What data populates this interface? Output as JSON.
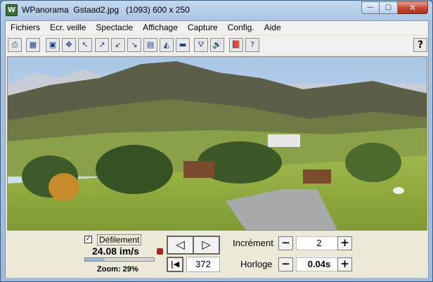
{
  "window": {
    "title": "WPanorama  Gstaad2.jpg   (1093) 600 x 250",
    "app_icon_glyph": "W",
    "minimize_glyph": "—",
    "maximize_glyph": "▢",
    "close_glyph": "✕"
  },
  "menu": {
    "items": [
      "Fichiers",
      "Ecr. veille",
      "Spectacle",
      "Affichage",
      "Capture",
      "Config.",
      "Aide"
    ]
  },
  "toolbar": {
    "buttons": [
      {
        "icon": "print-icon",
        "glyph": "⎙"
      },
      {
        "icon": "image-icon",
        "glyph": "▦"
      },
      {
        "icon": "fit-window-icon",
        "glyph": "▣"
      },
      {
        "icon": "expand-icon",
        "glyph": "✥"
      },
      {
        "icon": "shrink-icon",
        "glyph": "↖"
      },
      {
        "icon": "arrow-ne-icon",
        "glyph": "↗"
      },
      {
        "icon": "arrow-sw-icon",
        "glyph": "↙"
      },
      {
        "icon": "arrow-se-icon",
        "glyph": "↘"
      },
      {
        "icon": "landscape-view-icon",
        "glyph": "▤"
      },
      {
        "icon": "panorama-view-icon",
        "glyph": "◭"
      },
      {
        "icon": "strip-view-icon",
        "glyph": "▬"
      },
      {
        "icon": "bookmark-icon",
        "glyph": "⛛"
      },
      {
        "icon": "sound-icon",
        "glyph": "🔊"
      },
      {
        "icon": "book-icon",
        "glyph": "📕"
      },
      {
        "icon": "help-book-icon",
        "glyph": "?"
      }
    ],
    "help_glyph": "?"
  },
  "controls": {
    "scroll_checkbox_label": "Défilement",
    "scroll_checked_glyph": "✓",
    "speed": "24.08 im/s",
    "zoom_label": "Zoom: 29%",
    "zoom_fraction": 0.29,
    "prev_glyph": "◁",
    "next_glyph": "▷",
    "first_glyph": "|◀",
    "position": "372",
    "increment_label": "Incrément",
    "increment_value": "2",
    "clock_label": "Horloge",
    "clock_value": "0.04s",
    "minus_glyph": "−",
    "plus_glyph": "+"
  },
  "colors": {
    "sky": "#b9d3ec",
    "mountain": "#5a5a44",
    "grass": "#8faa3c",
    "road": "#a9a9a9"
  }
}
